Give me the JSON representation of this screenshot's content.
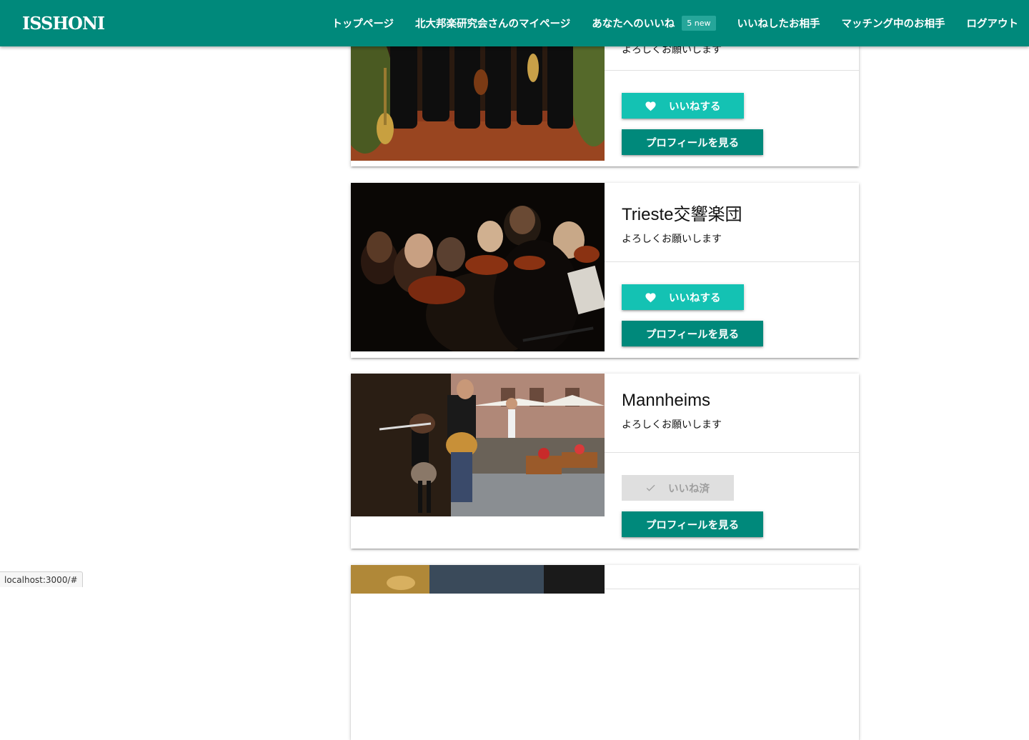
{
  "app": {
    "brand": "ISSHONI"
  },
  "nav": {
    "items": [
      {
        "label": "トップページ"
      },
      {
        "label": "北大邦楽研究会さんのマイページ"
      },
      {
        "label": "あなたへのいいね",
        "badge": "5 new"
      },
      {
        "label": "いいねしたお相手"
      },
      {
        "label": "マッチング中のお相手"
      },
      {
        "label": "ログアウト"
      }
    ]
  },
  "cards": [
    {
      "title": "",
      "description": "よろしくお願いします",
      "like_state": "like",
      "like_label": "いいねする",
      "profile_label": "プロフィールを見る",
      "image": "ensemble-with-instruments"
    },
    {
      "title": "Trieste交響楽団",
      "description": "よろしくお願いします",
      "like_state": "like",
      "like_label": "いいねする",
      "profile_label": "プロフィールを見る",
      "image": "orchestra-violins"
    },
    {
      "title": "Mannheims",
      "description": "よろしくお願いします",
      "like_state": "liked",
      "like_label": "いいね済",
      "profile_label": "プロフィールを見る",
      "image": "street-musicians"
    },
    {
      "title": "",
      "image": "brass-instruments"
    }
  ],
  "icons": {
    "like": "heart-icon",
    "liked": "check-icon"
  },
  "colors": {
    "navbar": "#00897b",
    "like_button": "#14c2b3",
    "profile_button": "#00897b",
    "liked_button": "#dfdfdf"
  },
  "status_bar": {
    "url": "localhost:3000/#"
  }
}
